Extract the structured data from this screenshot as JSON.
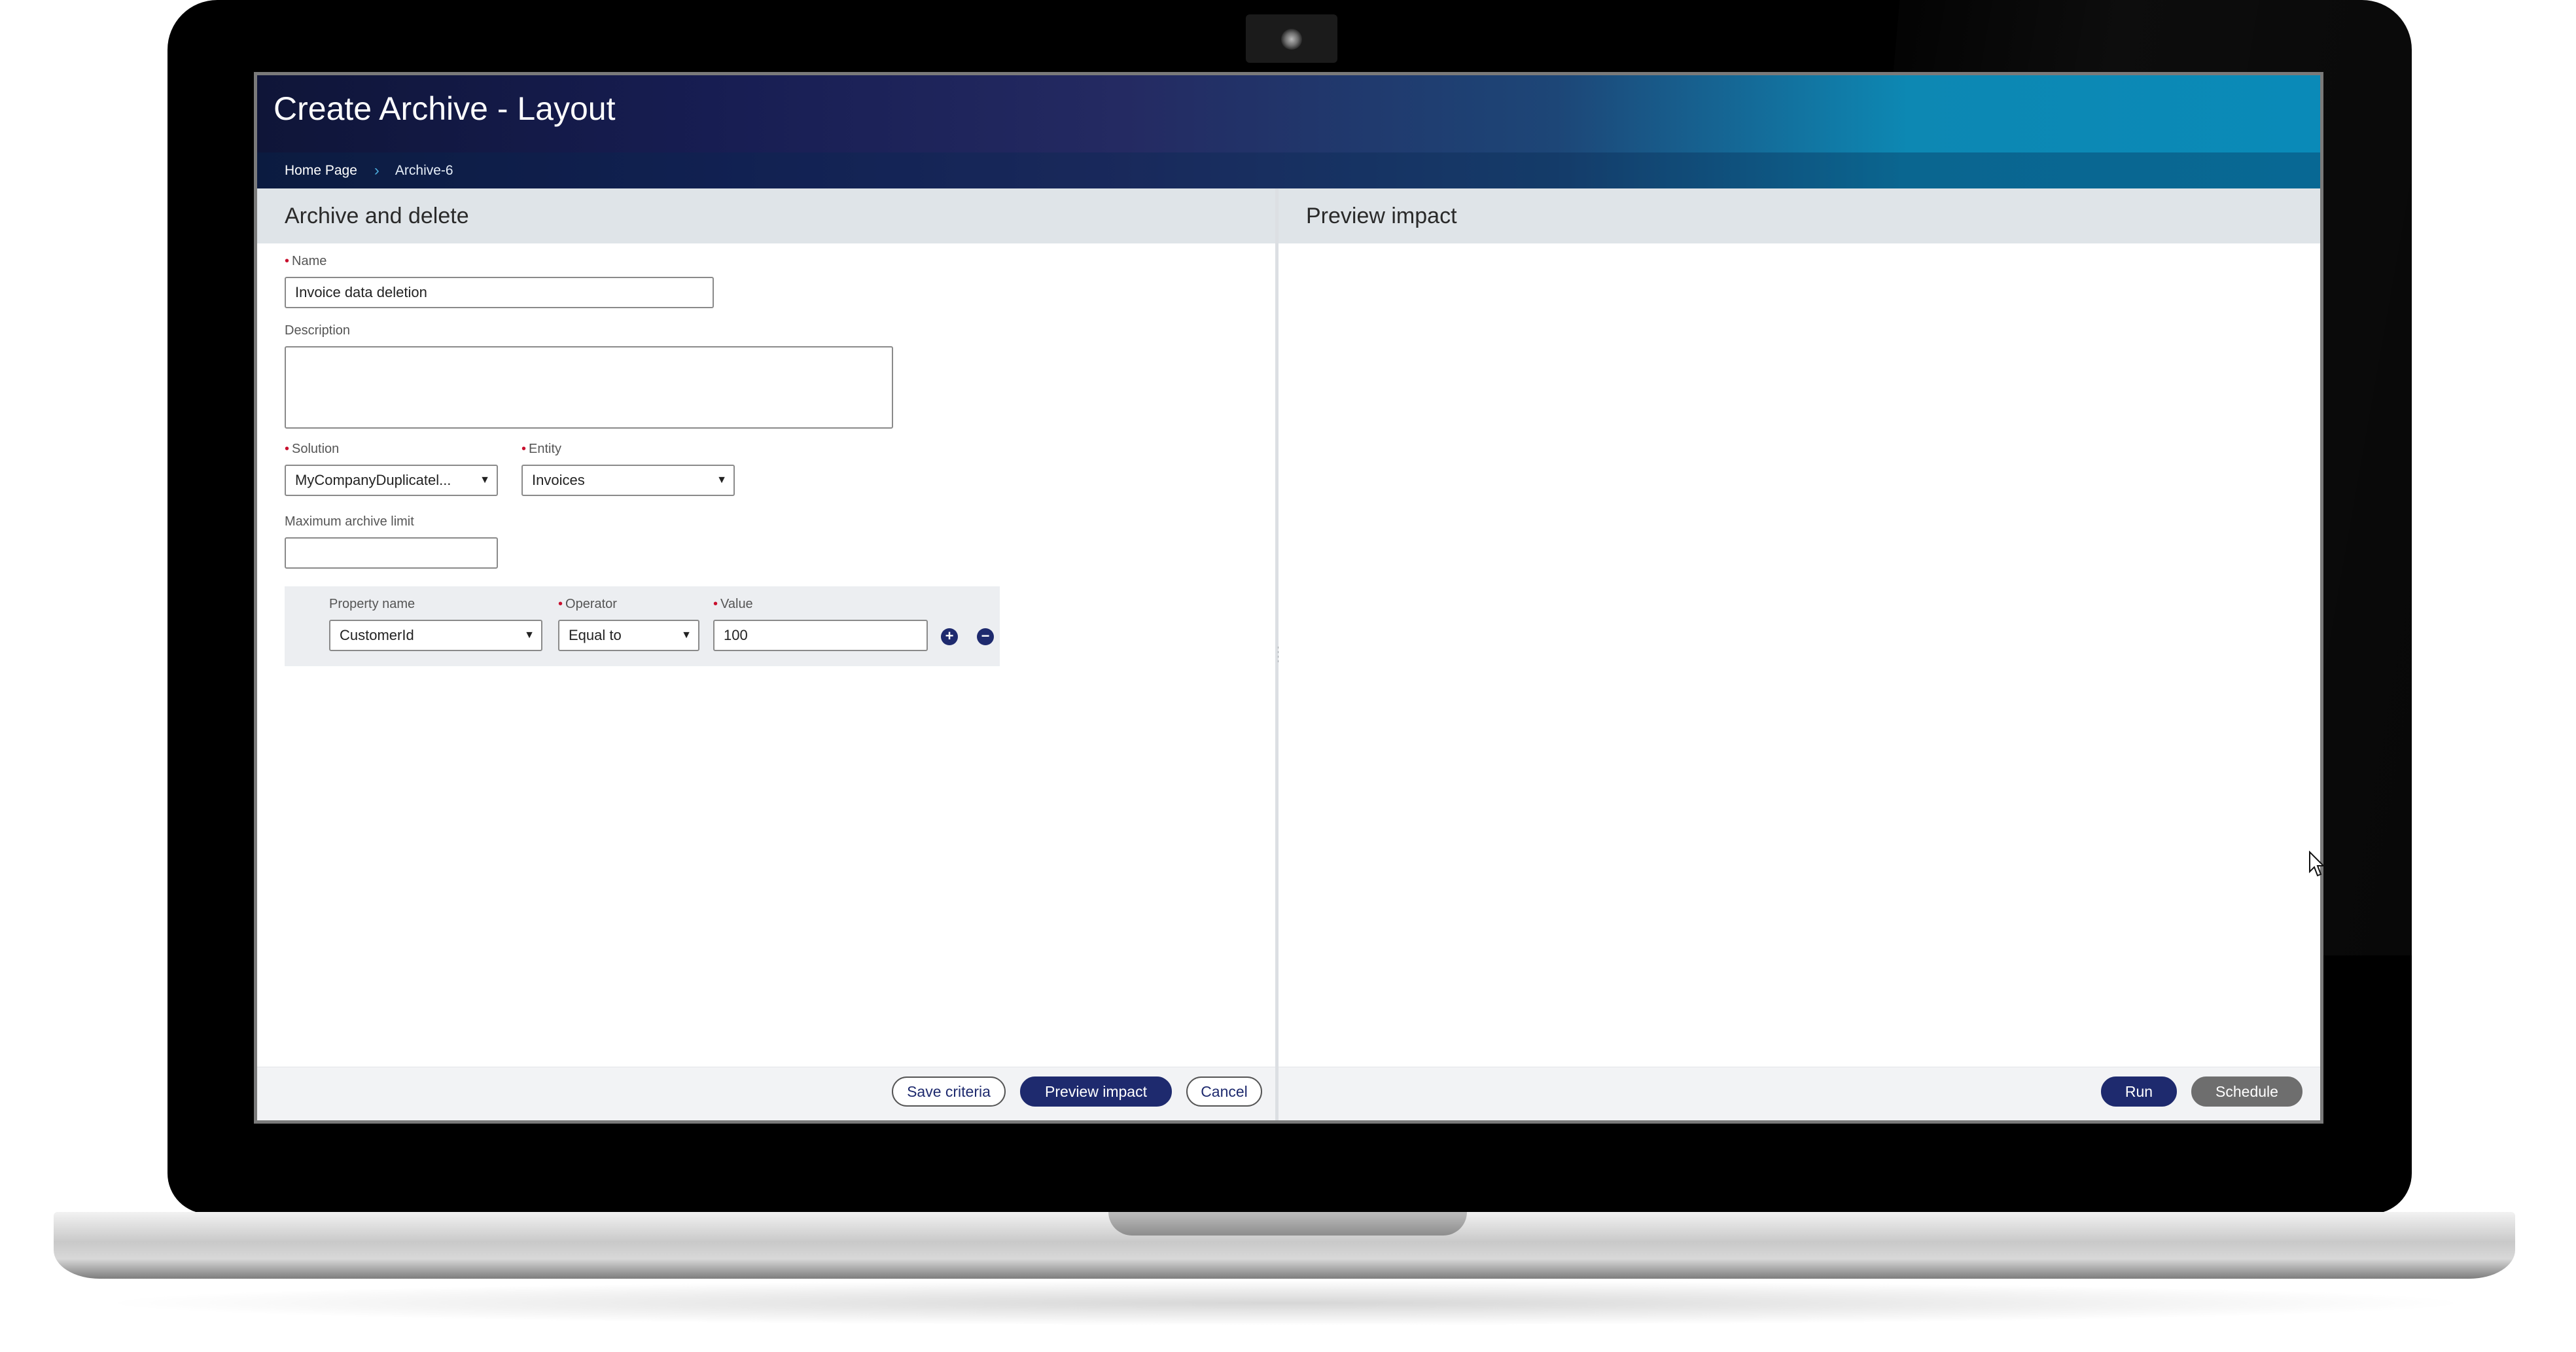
{
  "app": {
    "title": "Create Archive - Layout"
  },
  "breadcrumb": {
    "items": [
      "Home Page",
      "Archive-6"
    ]
  },
  "left_panel": {
    "title": "Archive and delete",
    "name_label": "Name",
    "name_value": "Invoice data deletion",
    "description_label": "Description",
    "description_value": "",
    "solution_label": "Solution",
    "solution_value": "MyCompanyDuplicatel...",
    "entity_label": "Entity",
    "entity_value": "Invoices",
    "max_limit_label": "Maximum archive limit",
    "max_limit_value": "",
    "criteria": {
      "property_label": "Property name",
      "property_value": "CustomerId",
      "operator_label": "Operator",
      "operator_value": "Equal to",
      "value_label": "Value",
      "value_value": "100"
    },
    "buttons": {
      "save_criteria": "Save criteria",
      "preview_impact": "Preview impact",
      "cancel": "Cancel"
    }
  },
  "right_panel": {
    "title": "Preview impact",
    "buttons": {
      "run": "Run",
      "schedule": "Schedule"
    }
  },
  "icons": {
    "add": "plus-circle-icon",
    "remove": "minus-circle-icon",
    "dropdown": "chevron-down-icon",
    "breadcrumb_separator": "chevron-right-icon",
    "camera": "camera-icon",
    "cursor": "mouse-pointer-icon"
  },
  "colors": {
    "primary": "#1e2a6e",
    "required": "#c8102e",
    "header_start": "#0f1538",
    "header_end": "#0a8ab8"
  }
}
